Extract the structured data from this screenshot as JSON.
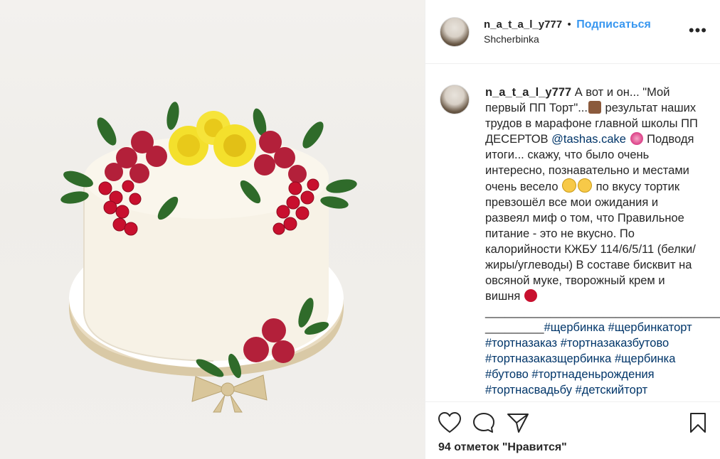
{
  "post": {
    "username": "n_a_t_a_l_y777",
    "follow_label": "Подписаться",
    "location": "Shcherbinka",
    "more_label": "•••"
  },
  "caption": {
    "username": "n_a_t_a_l_y777",
    "part1": "А вот и он... \"Мой первый ПП Торт\"...",
    "part2": " результат наших трудов в марафоне главной школы ПП ДЕСЕРТОВ ",
    "mention": "@tashas.cake",
    "part3": " Подводя итоги... скажу, что было очень интересно, познавательно и местами очень весело ",
    "part4": " по вкусу тортик превзошёл все мои ожидания и развеял миф о том, что Правильное питание - это не вкусно. По калорийности КЖБУ 114/6/5/11 (белки/жиры/углеводы) В составе бисквит на овсяной муке, творожный крем и вишня ",
    "separator": "_______________________________________",
    "separator2": "_________",
    "hashtags": [
      "#щербинка",
      "#щербинкаторт",
      "#тортназаказ",
      "#тортназаказбутово",
      "#тортназаказщербинка",
      "#щербинка",
      "#бутово",
      "#тортнаденьрождения",
      "#тортнасвадьбу",
      "#детскийторт"
    ]
  },
  "icons": {
    "like": "heart-icon",
    "comment": "comment-icon",
    "share": "share-icon",
    "save": "bookmark-icon",
    "more": "more-icon"
  },
  "likes_text": "94 отметок \"Нравится\"",
  "colors": {
    "link": "#3897f0",
    "mention": "#003569",
    "text": "#262626",
    "border": "#efefef"
  }
}
